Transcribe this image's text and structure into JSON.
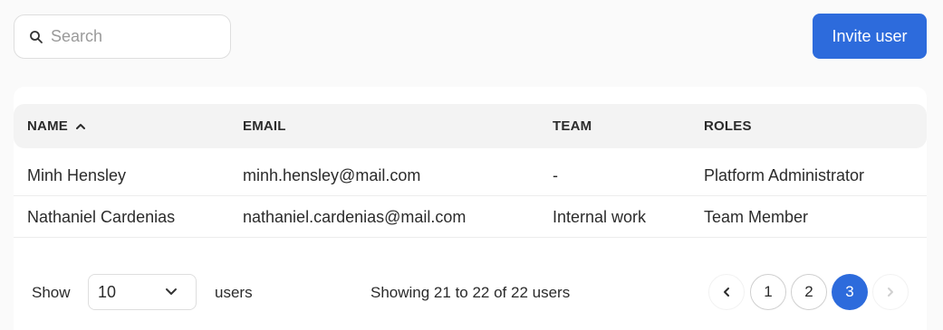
{
  "search": {
    "placeholder": "Search"
  },
  "toolbar": {
    "invite_label": "Invite user"
  },
  "colors": {
    "accent": "#2d6bdc"
  },
  "table": {
    "sorted_column": "NAME",
    "sort_direction": "ascending",
    "headers": [
      "NAME",
      "EMAIL",
      "TEAM",
      "ROLES"
    ],
    "rows": [
      {
        "name": "Minh Hensley",
        "email": "minh.hensley@mail.com",
        "team": "-",
        "roles": "Platform Administrator"
      },
      {
        "name": "Nathaniel Cardenias",
        "email": "nathaniel.cardenias@mail.com",
        "team": "Internal work",
        "roles": "Team Member"
      }
    ]
  },
  "footer": {
    "show_label": "Show",
    "page_size": "10",
    "users_label": "users",
    "summary": "Showing 21 to 22 of 22 users"
  },
  "pagination": {
    "pages": [
      "1",
      "2",
      "3"
    ],
    "current": "3",
    "prev_icon": "chevron-left-icon",
    "next_icon": "chevron-right-icon"
  }
}
